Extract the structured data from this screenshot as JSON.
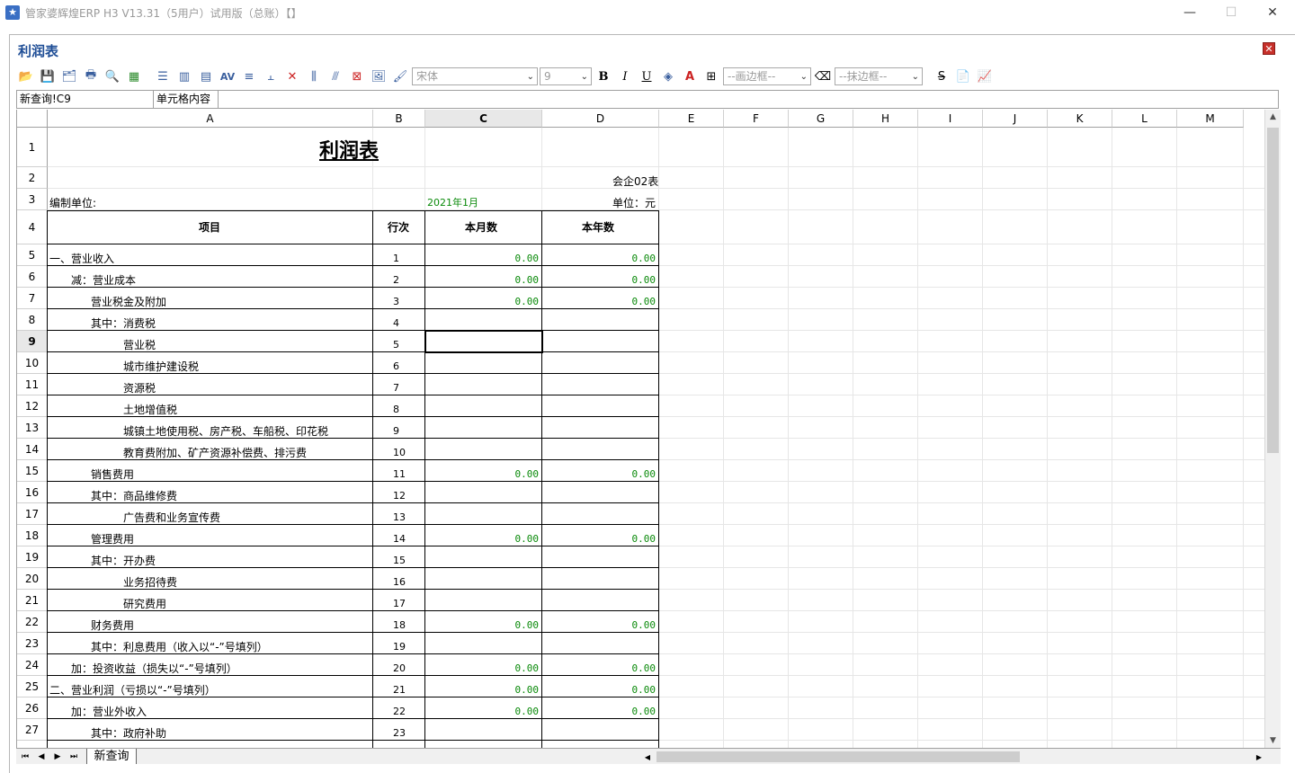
{
  "window": {
    "title": "管家婆辉煌ERP H3 V13.31（5用户）试用版（总账）【】",
    "minimize": "—",
    "maximize": "☐",
    "close": "✕"
  },
  "inner": {
    "title": "利润表",
    "close": "✕"
  },
  "toolbar": {
    "font_name": "宋体",
    "font_size": "9",
    "bold": "B",
    "italic": "I",
    "underline": "U",
    "draw_border": "--画边框--",
    "erase_border": "--抹边框--",
    "strike": "S",
    "letter_spacing": "AV"
  },
  "formula_bar": {
    "cell_ref": "新查询!C9",
    "label": "单元格内容",
    "content": ""
  },
  "columns": [
    "A",
    "B",
    "C",
    "D",
    "E",
    "F",
    "G",
    "H",
    "I",
    "J",
    "K",
    "L",
    "M"
  ],
  "rows": [
    "1",
    "2",
    "3",
    "4",
    "5",
    "6",
    "7",
    "8",
    "9",
    "10",
    "11",
    "12",
    "13",
    "14",
    "15",
    "16",
    "17",
    "18",
    "19",
    "20",
    "21",
    "22",
    "23",
    "24",
    "25",
    "26",
    "27"
  ],
  "report": {
    "title": "利润表",
    "form_code": "会企02表",
    "org_label": "编制单位:",
    "period": "2021年1月",
    "unit": "单位：元",
    "headers": {
      "item": "项目",
      "line": "行次",
      "month": "本月数",
      "year": "本年数"
    },
    "items": [
      {
        "label": "一、营业收入",
        "line": "1",
        "month": "0.00",
        "year": "0.00"
      },
      {
        "label": "减：营业成本",
        "line": "2",
        "month": "0.00",
        "year": "0.00"
      },
      {
        "label": "营业税金及附加",
        "line": "3",
        "month": "0.00",
        "year": "0.00"
      },
      {
        "label": "其中：消费税",
        "line": "4",
        "month": "",
        "year": ""
      },
      {
        "label": "营业税",
        "line": "5",
        "month": "",
        "year": ""
      },
      {
        "label": "城市维护建设税",
        "line": "6",
        "month": "",
        "year": ""
      },
      {
        "label": "资源税",
        "line": "7",
        "month": "",
        "year": ""
      },
      {
        "label": "土地增值税",
        "line": "8",
        "month": "",
        "year": ""
      },
      {
        "label": "城镇土地使用税、房产税、车船税、印花税",
        "line": "9",
        "month": "",
        "year": ""
      },
      {
        "label": "教育费附加、矿产资源补偿费、排污费",
        "line": "10",
        "month": "",
        "year": ""
      },
      {
        "label": "销售费用",
        "line": "11",
        "month": "0.00",
        "year": "0.00"
      },
      {
        "label": "其中：商品维修费",
        "line": "12",
        "month": "",
        "year": ""
      },
      {
        "label": "广告费和业务宣传费",
        "line": "13",
        "month": "",
        "year": ""
      },
      {
        "label": "管理费用",
        "line": "14",
        "month": "0.00",
        "year": "0.00"
      },
      {
        "label": "其中：开办费",
        "line": "15",
        "month": "",
        "year": ""
      },
      {
        "label": "业务招待费",
        "line": "16",
        "month": "",
        "year": ""
      },
      {
        "label": "研究费用",
        "line": "17",
        "month": "",
        "year": ""
      },
      {
        "label": "财务费用",
        "line": "18",
        "month": "0.00",
        "year": "0.00"
      },
      {
        "label": "其中：利息费用（收入以“-”号填列）",
        "line": "19",
        "month": "",
        "year": ""
      },
      {
        "label": "加：投资收益（损失以“-”号填列）",
        "line": "20",
        "month": "0.00",
        "year": "0.00"
      },
      {
        "label": "二、营业利润（亏损以“-”号填列）",
        "line": "21",
        "month": "0.00",
        "year": "0.00"
      },
      {
        "label": "加：营业外收入",
        "line": "22",
        "month": "0.00",
        "year": "0.00"
      },
      {
        "label": "其中：政府补助",
        "line": "23",
        "month": "",
        "year": ""
      }
    ]
  },
  "sheet_tabs": [
    "新查询"
  ],
  "nav": {
    "first": "⏮",
    "prev": "◀",
    "next": "▶",
    "last": "⏭"
  }
}
